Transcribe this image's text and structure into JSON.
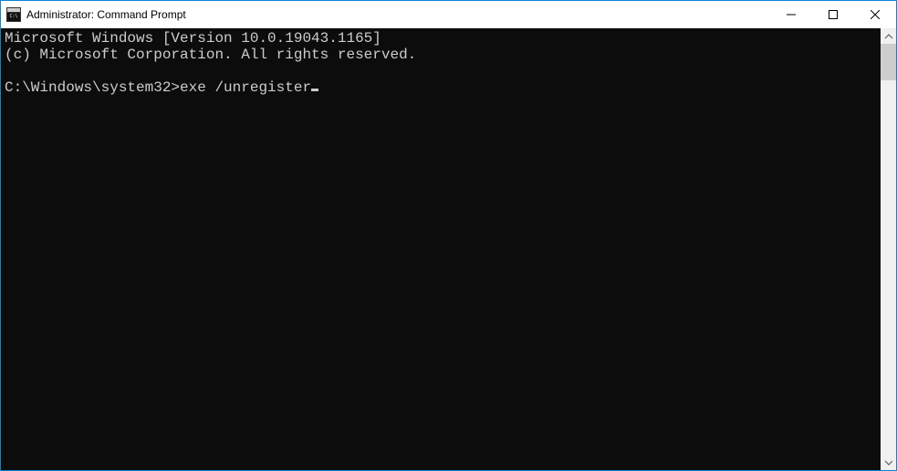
{
  "titlebar": {
    "title": "Administrator: Command Prompt",
    "icon_label": "C:\\"
  },
  "console": {
    "line1": "Microsoft Windows [Version 10.0.19043.1165]",
    "line2": "(c) Microsoft Corporation. All rights reserved.",
    "blank": "",
    "prompt": "C:\\Windows\\system32>",
    "command": "exe /unregister"
  }
}
